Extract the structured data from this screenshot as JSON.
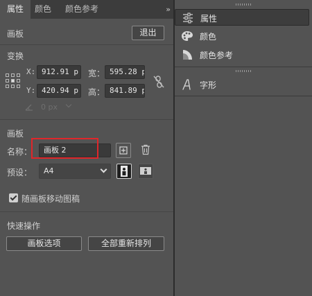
{
  "tabs": [
    "属性",
    "颜色",
    "颜色参考"
  ],
  "tab_overflow": "››",
  "artboard_header": {
    "section_label": "画板",
    "exit_button": "退出"
  },
  "transform": {
    "section_label": "变换",
    "x_label": "X:",
    "x_value": "912.91 p",
    "y_label": "Y:",
    "y_value": "420.94 p",
    "width_label": "宽：",
    "width_value": "595.28 p",
    "height_label": "高：",
    "height_value": "841.89 p",
    "rotate_value": "0 px"
  },
  "artboard": {
    "section_label": "画板",
    "name_label": "名称：",
    "name_value": "画板 2",
    "preset_label": "预设：",
    "preset_value": "A4"
  },
  "move_artwork": {
    "checked": true,
    "label": "随画板移动图稿"
  },
  "quick_actions": {
    "section_label": "快速操作",
    "artboard_options": "画板选项",
    "rearrange_all": "全部重新排列"
  },
  "right_panel": {
    "items": [
      "属性",
      "颜色",
      "颜色参考"
    ],
    "glyphs_item": "字形"
  },
  "colors": {
    "highlight_box": "#e0262a",
    "panel_bg": "#535353",
    "selected_bg": "#3d3d3d"
  }
}
